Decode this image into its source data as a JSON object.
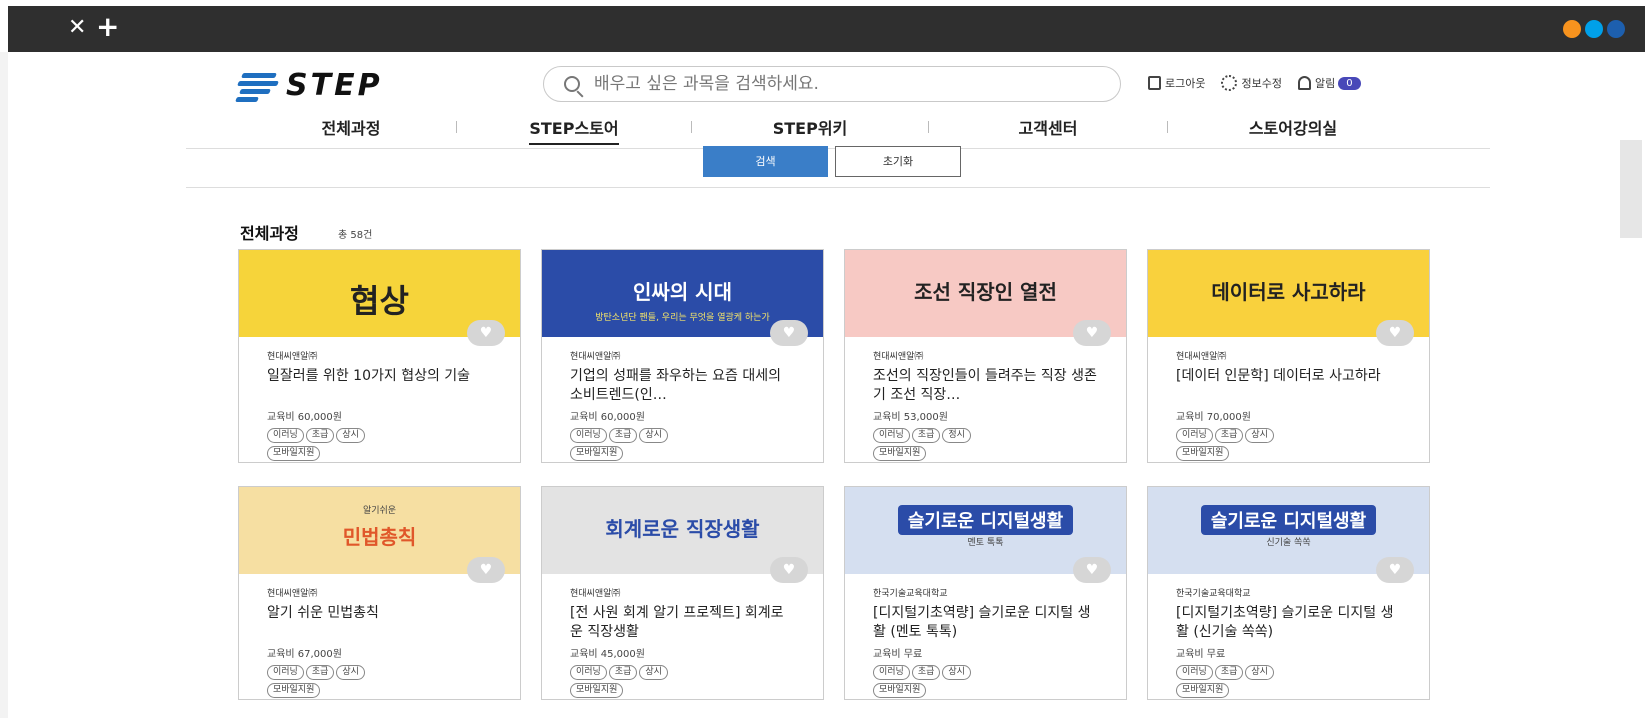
{
  "browser": {
    "close_glyph": "✕",
    "new_tab_glyph": "+",
    "dot_colors": [
      "#f7931e",
      "#00a0e9",
      "#1d5fae"
    ]
  },
  "header": {
    "logo_text": "STEP",
    "search_placeholder": "배우고 싶은 과목을 검색하세요.",
    "logout_label": "로그아웃",
    "profile_label": "정보수정",
    "alert_label": "알림",
    "alert_count": "0"
  },
  "nav": {
    "items": [
      {
        "label": "전체과정"
      },
      {
        "label": "STEP스토어"
      },
      {
        "label": "STEP위키"
      },
      {
        "label": "고객센터"
      },
      {
        "label": "스토어강의실"
      }
    ],
    "active_index": 1
  },
  "filter": {
    "search_button": "검색",
    "reset_button": "초기화"
  },
  "list": {
    "title": "전체과정",
    "count": "총 58건"
  },
  "courses": [
    {
      "provider": "현대씨앤알㈜",
      "title": "일잘러를 위한 10가지 협상의 기술",
      "fee": "교육비 60,000원",
      "tags": [
        "이러닝",
        "초급",
        "상시",
        "모바일지원"
      ],
      "thumb_text": "협상",
      "thumb_bg": "#f6d43a"
    },
    {
      "provider": "현대씨앤알㈜",
      "title": "기업의 성패를 좌우하는 요즘 대세의 소비트렌드(인…",
      "fee": "교육비 60,000원",
      "tags": [
        "이러닝",
        "초급",
        "상시",
        "모바일지원"
      ],
      "thumb_text": "인싸의 시대",
      "thumb_sub": "방탄소년단 팬들, 우리는 무엇을 열광케 하는가",
      "thumb_bg": "#2b4ca8"
    },
    {
      "provider": "현대씨앤알㈜",
      "title": "조선의 직장인들이 들려주는 직장 생존기 조선 직장…",
      "fee": "교육비 53,000원",
      "tags": [
        "이러닝",
        "초급",
        "정시",
        "모바일지원"
      ],
      "thumb_text": "조선 직장인 열전",
      "thumb_bg": "#f7c9c4"
    },
    {
      "provider": "현대씨앤알㈜",
      "title": "[데이터 인문학] 데이터로 사고하라",
      "fee": "교육비 70,000원",
      "tags": [
        "이러닝",
        "초급",
        "상시",
        "모바일지원"
      ],
      "thumb_text": "데이터로 사고하라",
      "thumb_bg": "#f9d13d"
    },
    {
      "provider": "현대씨앤알㈜",
      "title": "알기 쉬운 민법총칙",
      "fee": "교육비 67,000원",
      "tags": [
        "이러닝",
        "초급",
        "상시",
        "모바일지원"
      ],
      "thumb_text": "민법총칙",
      "thumb_sub": "알기쉬운",
      "thumb_bg": "#f6dfa2"
    },
    {
      "provider": "현대씨앤알㈜",
      "title": "[전 사원 회계 알기 프로젝트] 회계로운 직장생활",
      "fee": "교육비 45,000원",
      "tags": [
        "이러닝",
        "초급",
        "상시",
        "모바일지원"
      ],
      "thumb_text": "회계로운 직장생활",
      "thumb_bg": "#e3e3e3"
    },
    {
      "provider": "한국기술교육대학교",
      "title": "[디지털기초역량] 슬기로운 디지털 생활 (멘토 톡톡)",
      "fee": "교육비 무료",
      "tags": [
        "이러닝",
        "초급",
        "상시",
        "모바일지원"
      ],
      "thumb_text": "슬기로운 디지털생활",
      "thumb_sub": "멘토 톡톡",
      "thumb_bg": "#d5dff0"
    },
    {
      "provider": "한국기술교육대학교",
      "title": "[디지털기초역량] 슬기로운 디지털 생활 (신기술 쏙쏙)",
      "fee": "교육비 무료",
      "tags": [
        "이러닝",
        "초급",
        "상시",
        "모바일지원"
      ],
      "thumb_text": "슬기로운 디지털생활",
      "thumb_sub": "신기술 쏙쏙",
      "thumb_bg": "#d5dff0"
    }
  ]
}
